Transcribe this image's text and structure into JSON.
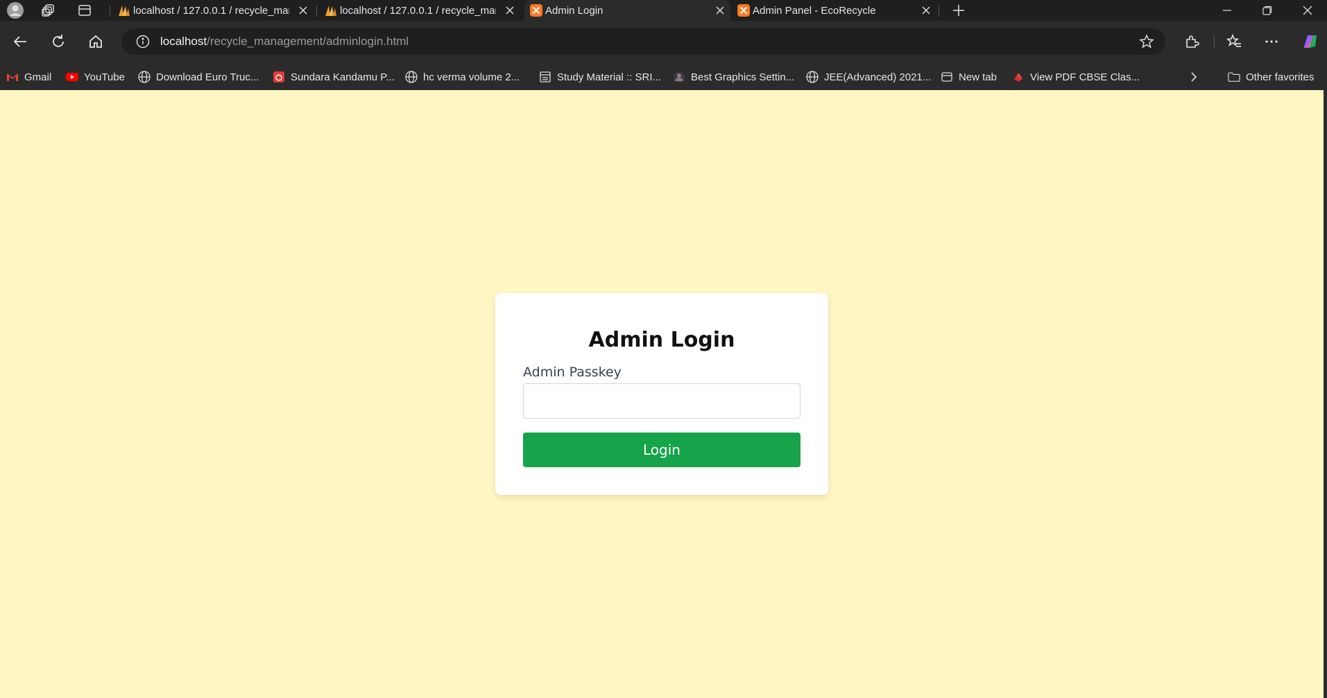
{
  "browser": {
    "tabs": [
      {
        "title": "localhost / 127.0.0.1 / recycle_mar",
        "favicon": "phpmyadmin-icon",
        "active": false
      },
      {
        "title": "localhost / 127.0.0.1 / recycle_mar",
        "favicon": "phpmyadmin-icon",
        "active": false
      },
      {
        "title": "Admin Login",
        "favicon": "xampp-icon",
        "active": true
      },
      {
        "title": "Admin Panel - EcoRecycle",
        "favicon": "xampp-icon",
        "active": false
      }
    ],
    "address_bar": {
      "host": "localhost",
      "path": "/recycle_management/adminlogin.html"
    },
    "bookmarks": [
      {
        "label": "Gmail",
        "icon": "gmail-icon"
      },
      {
        "label": "YouTube",
        "icon": "youtube-icon"
      },
      {
        "label": "Download Euro Truc...",
        "icon": "globe-icon"
      },
      {
        "label": "Sundara Kandamu P...",
        "icon": "red-app-icon"
      },
      {
        "label": "hc verma volume 2...",
        "icon": "globe-icon"
      },
      {
        "label": "Study Material :: SRI...",
        "icon": "study-icon"
      },
      {
        "label": "Best Graphics Settin...",
        "icon": "avatar-icon"
      },
      {
        "label": "JEE(Advanced) 2021...",
        "icon": "globe-icon"
      },
      {
        "label": "New tab",
        "icon": "newtab-icon"
      },
      {
        "label": "View PDF CBSE Clas...",
        "icon": "pdf-icon"
      }
    ],
    "other_favorites": "Other favorites"
  },
  "page": {
    "title": "Admin Login",
    "passkey_label": "Admin Passkey",
    "passkey_value": "",
    "login_label": "Login"
  },
  "colors": {
    "page_background": "#fef7c3",
    "button": "#16a34a",
    "card": "#ffffff"
  }
}
